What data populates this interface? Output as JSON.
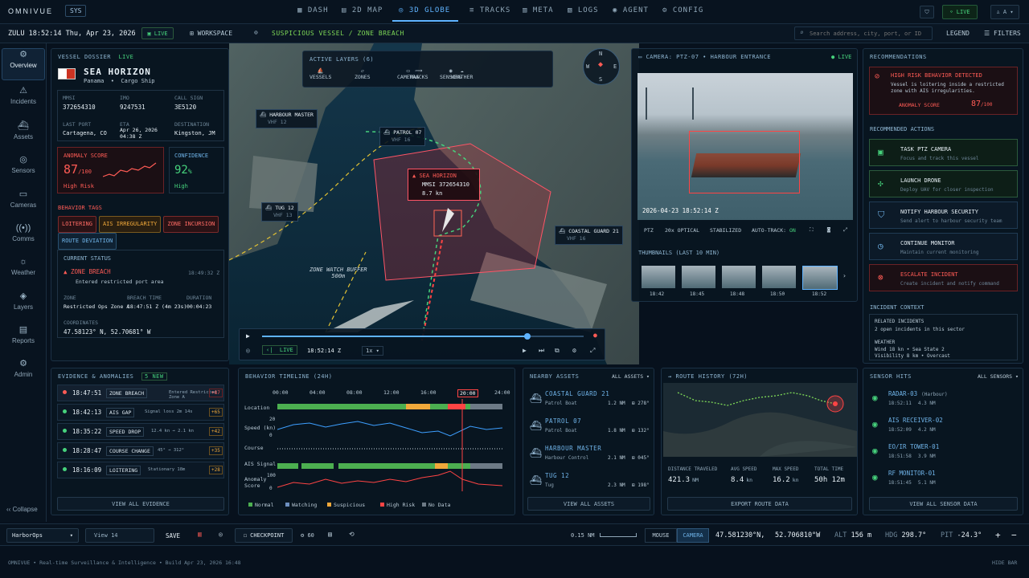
{
  "app": {
    "brand": "OMNIVUE",
    "sys": "SYS",
    "status": "LIVE",
    "user": "A"
  },
  "nav": [
    "DASH",
    "2D MAP",
    "3D GLOBE",
    "TRACKS",
    "META",
    "LOGS",
    "AGENT",
    "CONFIG"
  ],
  "subbar": {
    "time": "ZULU 18:52:14 Thu, Apr 23, 2026",
    "live": "LIVE",
    "workspace": "WORKSPACE",
    "alert": "SUSPICIOUS VESSEL / ZONE BREACH",
    "search_placeholder": "Search address, city, port, or ID",
    "legend": "LEGEND",
    "filters": "FILTERS"
  },
  "sidebar": [
    "Overview",
    "Incidents",
    "Assets",
    "Sensors",
    "Cameras",
    "Comms",
    "Weather",
    "Layers",
    "Reports",
    "Admin"
  ],
  "sidebar_collapse": "Collapse",
  "dossier": {
    "title": "VESSEL DOSSIER",
    "live": "LIVE",
    "name": "SEA HORIZON",
    "flag_country": "Panama",
    "type": "Cargo Ship",
    "fields": [
      {
        "k": "MMSI",
        "v": "372654310"
      },
      {
        "k": "IMO",
        "v": "9247531"
      },
      {
        "k": "CALL SIGN",
        "v": "3E5120"
      },
      {
        "k": "LAST PORT",
        "v": "Cartagena, CO"
      },
      {
        "k": "ETA",
        "v": "Apr 26, 2026 04:38 Z"
      },
      {
        "k": "DESTINATION",
        "v": "Kingston, JM"
      }
    ],
    "anomaly_label": "ANOMALY SCORE",
    "anomaly": "87",
    "anomaly_max": "/100",
    "anomaly_risk": "High Risk",
    "confidence_label": "CONFIDENCE",
    "confidence": "92",
    "confidence_unit": "%",
    "confidence_level": "High",
    "tags_title": "BEHAVIOR TAGS",
    "tags": [
      "LOITERING",
      "AIS IRREGULARITY",
      "ZONE INCURSION",
      "ROUTE DEVIATION"
    ],
    "status_title": "CURRENT STATUS",
    "status": "ZONE BREACH",
    "status_time": "18:49:32 Z",
    "status_desc": "Entered restricted port area",
    "zone_label": "ZONE",
    "zone": "Restricted Ops Zone A",
    "breach_label": "BREACH TIME",
    "breach": "18:47:51 Z (4m 23s)",
    "dur_label": "DURATION",
    "dur": "00:04:23",
    "coord_label": "COORDINATES",
    "coords": "47.58123° N, 52.70681° W"
  },
  "layers": {
    "title": "ACTIVE LAYERS (6)",
    "items": [
      "VESSELS",
      "ZONES",
      "CAMERAS",
      "SENSORS",
      "TRACKS",
      "WEATHER"
    ]
  },
  "map": {
    "labels": [
      {
        "n": "HARBOUR MASTER",
        "s": "VHF 12"
      },
      {
        "n": "PATROL 07",
        "s": "VHF 16"
      },
      {
        "n": "TUG 12",
        "s": "VHF 13"
      },
      {
        "n": "COASTAL GUARD 21",
        "s": "VHF 16"
      }
    ],
    "target": {
      "n": "SEA HORIZON",
      "mmsi": "MMSI 372654310",
      "spd": "8.7 kn"
    },
    "buffer": "ZONE WATCH BUFFER",
    "buffer_dist": "500m",
    "compass": {
      "n": "N",
      "s": "S",
      "e": "E",
      "w": "W"
    },
    "playback": {
      "live": "LIVE",
      "time": "18:52:14 Z",
      "speed": "1x"
    }
  },
  "camera": {
    "title": "CAMERA: PTZ-07 • HARBOUR ENTRANCE",
    "live": "LIVE",
    "stamp": "2026-04-23 18:52:14 Z",
    "ctrls": [
      "PTZ",
      "20x OPTICAL",
      "STABILIZED",
      "AUTO-TRACK:"
    ],
    "autotrack": "ON",
    "thumbs_title": "THUMBNAILS (LAST 10 MIN)",
    "thumbs": [
      "18:42",
      "18:45",
      "18:48",
      "18:50",
      "18:52"
    ]
  },
  "recs": {
    "title": "RECOMMENDATIONS",
    "alert_title": "HIGH RISK BEHAVIOR DETECTED",
    "alert_desc": "Vessel is loitering inside a restricted zone with AIS irregularities.",
    "score_label": "ANOMALY SCORE",
    "score": "87",
    "score_max": "/100",
    "actions_title": "RECOMMENDED ACTIONS",
    "actions": [
      {
        "t": "TASK PTZ CAMERA",
        "d": "Focus and track this vessel"
      },
      {
        "t": "LAUNCH DRONE",
        "d": "Deploy UAV for closer inspection"
      },
      {
        "t": "NOTIFY HARBOUR SECURITY",
        "d": "Send alert to harbour security team"
      },
      {
        "t": "CONTINUE MONITOR",
        "d": "Maintain current monitoring"
      },
      {
        "t": "ESCALATE INCIDENT",
        "d": "Create incident and notify command"
      }
    ],
    "ctx_title": "INCIDENT CONTEXT",
    "rel_label": "RELATED INCIDENTS",
    "rel": "2 open incidents in this sector",
    "wx_label": "WEATHER",
    "wx1": "Wind 18 kn  •  Sea State 2",
    "wx2": "Visibility 8 km  •  Overcast"
  },
  "evidence": {
    "title": "EVIDENCE & ANOMALIES",
    "badge": "5 NEW",
    "rows": [
      {
        "t": "18:47:51",
        "tag": "ZONE BREACH",
        "d": "Entered Restricted Zone A",
        "s": "+87"
      },
      {
        "t": "18:42:13",
        "tag": "AIS GAP",
        "d": "Signal loss 2m 14s",
        "s": "+65"
      },
      {
        "t": "18:35:22",
        "tag": "SPEED DROP",
        "d": "12.4 kn → 2.1 kn",
        "s": "+42"
      },
      {
        "t": "18:28:47",
        "tag": "COURSE CHANGE",
        "d": "45° → 312°",
        "s": "+35"
      },
      {
        "t": "18:16:09",
        "tag": "LOITERING",
        "d": "Stationary 18m",
        "s": "+28"
      }
    ],
    "footer": "VIEW ALL EVIDENCE"
  },
  "timeline": {
    "title": "BEHAVIOR TIMELINE (24H)",
    "ticks": [
      "00:00",
      "04:00",
      "08:00",
      "12:00",
      "16:00",
      "20:00",
      "24:00"
    ],
    "rows": [
      "Location",
      "Speed (kn)",
      "Course",
      "AIS Signal",
      "Anomaly Score"
    ],
    "y_speed": [
      "20",
      "0"
    ],
    "y_anom": [
      "100",
      "0"
    ],
    "legend": [
      "Normal",
      "Watching",
      "Suspicious",
      "High Risk",
      "No Data"
    ]
  },
  "assets": {
    "title": "NEARBY ASSETS",
    "filter": "ALL ASSETS",
    "rows": [
      {
        "n": "COASTAL GUARD 21",
        "t": "Patrol Boat",
        "d": "1.2 NM",
        "b": "278°"
      },
      {
        "n": "PATROL 07",
        "t": "Patrol Boat",
        "d": "1.8 NM",
        "b": "132°"
      },
      {
        "n": "HARBOUR MASTER",
        "t": "Harbour Control",
        "d": "2.1 NM",
        "b": "045°"
      },
      {
        "n": "TUG 12",
        "t": "Tug",
        "d": "2.3 NM",
        "b": "198°"
      }
    ],
    "footer": "VIEW ALL ASSETS"
  },
  "route": {
    "title": "ROUTE HISTORY (72H)",
    "stats": [
      {
        "k": "DISTANCE TRAVELED",
        "v": "421.3",
        "u": "NM"
      },
      {
        "k": "AVG SPEED",
        "v": "8.4",
        "u": "kn"
      },
      {
        "k": "MAX SPEED",
        "v": "16.2",
        "u": "kn"
      },
      {
        "k": "TOTAL TIME",
        "v": "50h 12m",
        "u": ""
      }
    ],
    "footer": "EXPORT ROUTE DATA"
  },
  "sensors": {
    "title": "SENSOR HITS",
    "filter": "ALL SENSORS",
    "rows": [
      {
        "n": "RADAR-03",
        "x": "(Harbour)",
        "t": "18:52:11",
        "d": "4.3 NM"
      },
      {
        "n": "AIS RECEIVER-02",
        "x": "",
        "t": "18:52:09",
        "d": "4.2 NM"
      },
      {
        "n": "EO/IR TOWER-01",
        "x": "",
        "t": "18:51:58",
        "d": "3.9 NM"
      },
      {
        "n": "RF MONITOR-01",
        "x": "",
        "t": "18:51:45",
        "d": "5.1 NM"
      }
    ],
    "footer": "VIEW ALL SENSOR DATA"
  },
  "bottombar": {
    "workspace": "HarborOps",
    "view": "View 14",
    "save": "SAVE",
    "checkpoint": "CHECKPOINT",
    "count": "60",
    "scale": "0.15 NM",
    "mouse": "MOUSE",
    "camera": "CAMERA",
    "lat": "47.581230°N,",
    "lon": "52.706810°W",
    "alt_label": "ALT",
    "alt": "156 m",
    "hdg_label": "HDG",
    "hdg": "298.7°",
    "pit_label": "PIT",
    "pit": "-24.3°"
  },
  "footer": {
    "text": "OMNIVUE • Real-time Surveillance & Intelligence • Build Apr 23, 2026 16:48",
    "hide": "HIDE BAR"
  },
  "colors": {
    "accent": "#5fb3ff",
    "danger": "#ff5b55",
    "ok": "#46d27c",
    "warn": "#f0a83a"
  }
}
